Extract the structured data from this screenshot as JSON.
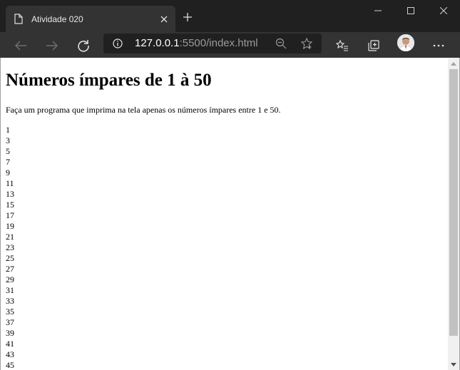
{
  "browser": {
    "tab_title": "Atividade 020",
    "url_host": "127.0.0.1",
    "url_rest": ":5500/index.html"
  },
  "page": {
    "heading": "Números ímpares de 1 à 50",
    "description": "Faça um programa que imprima na tela apenas os números ímpares entre 1 e 50.",
    "numbers": [
      "1",
      "3",
      "5",
      "7",
      "9",
      "11",
      "13",
      "15",
      "17",
      "19",
      "21",
      "23",
      "25",
      "27",
      "29",
      "31",
      "33",
      "35",
      "37",
      "39",
      "41",
      "43",
      "45"
    ]
  }
}
